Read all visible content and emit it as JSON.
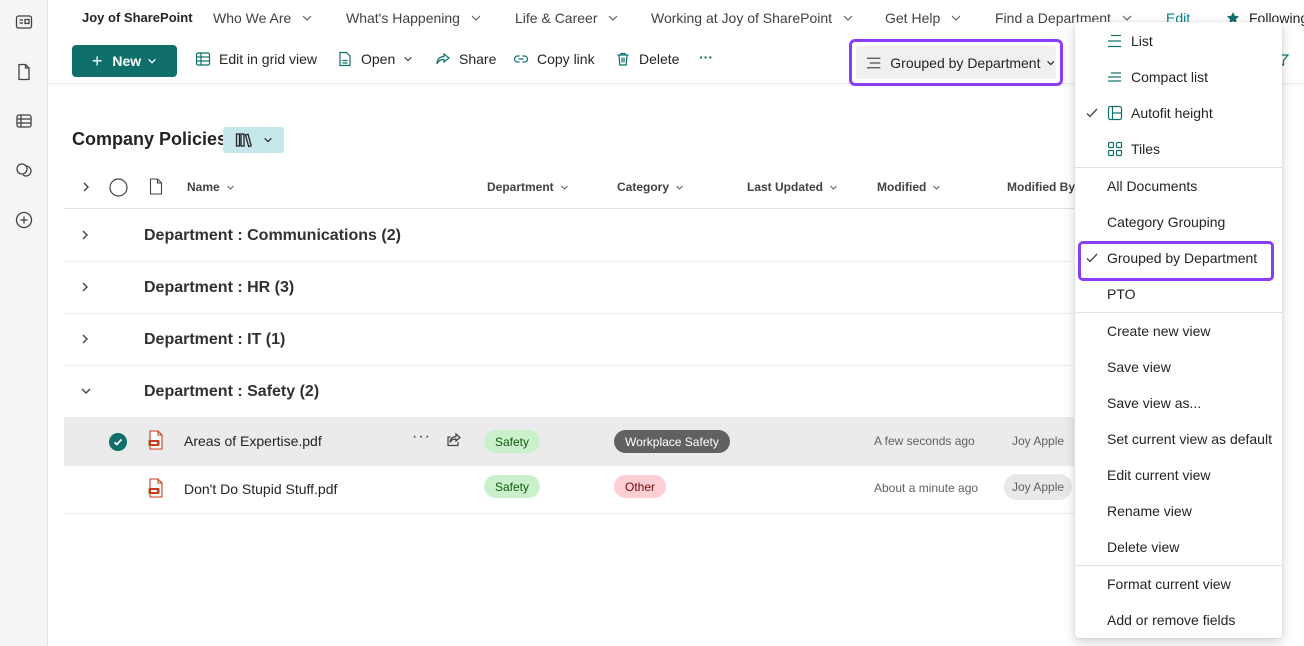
{
  "site": {
    "title": "Joy of SharePoint",
    "nav": [
      {
        "label": "Who We Are"
      },
      {
        "label": "What's Happening"
      },
      {
        "label": "Life & Career"
      },
      {
        "label": "Working at Joy of SharePoint"
      },
      {
        "label": "Get Help"
      },
      {
        "label": "Find a Department"
      }
    ],
    "edit_label": "Edit",
    "following_label": "Following"
  },
  "toolbar": {
    "new_label": "New",
    "edit_grid_label": "Edit in grid view",
    "open_label": "Open",
    "share_label": "Share",
    "copy_link_label": "Copy link",
    "delete_label": "Delete",
    "more_label": "···",
    "current_view_label": "Grouped by Department"
  },
  "library": {
    "title": "Company Policies",
    "columns": {
      "name": "Name",
      "department": "Department",
      "category": "Category",
      "last_updated": "Last Updated",
      "modified": "Modified",
      "modified_by": "Modified By"
    },
    "groups": [
      {
        "label": "Department : Communications (2)",
        "expanded": false
      },
      {
        "label": "Department : HR (3)",
        "expanded": false
      },
      {
        "label": "Department : IT (1)",
        "expanded": false
      },
      {
        "label": "Department : Safety (2)",
        "expanded": true
      }
    ],
    "items": [
      {
        "name": "Areas of Expertise.pdf",
        "department": "Safety",
        "category": "Workplace Safety",
        "modified": "A few seconds ago",
        "modified_by": "Joy Apple",
        "selected": true
      },
      {
        "name": "Don't Do Stupid Stuff.pdf",
        "department": "Safety",
        "category": "Other",
        "modified": "About a minute ago",
        "modified_by": "Joy Apple",
        "selected": false
      }
    ]
  },
  "view_menu": {
    "layouts": [
      {
        "label": "List",
        "checked": false,
        "icon": "list-icon"
      },
      {
        "label": "Compact list",
        "checked": false,
        "icon": "compact-list-icon"
      },
      {
        "label": "Autofit height",
        "checked": true,
        "icon": "autofit-icon"
      },
      {
        "label": "Tiles",
        "checked": false,
        "icon": "tiles-icon"
      }
    ],
    "views": [
      {
        "label": "All Documents",
        "checked": false
      },
      {
        "label": "Category Grouping",
        "checked": false
      },
      {
        "label": "Grouped by Department",
        "checked": true
      },
      {
        "label": "PTO",
        "checked": false
      }
    ],
    "actions": [
      {
        "label": "Create new view"
      },
      {
        "label": "Save view"
      },
      {
        "label": "Save view as..."
      },
      {
        "label": "Set current view as default"
      },
      {
        "label": "Edit current view"
      },
      {
        "label": "Rename view"
      },
      {
        "label": "Delete view"
      }
    ],
    "format": [
      {
        "label": "Format current view"
      },
      {
        "label": "Add or remove fields"
      }
    ]
  },
  "colors": {
    "accent": "#0f6f6b",
    "highlight": "#8a3ff5",
    "safety_pill": "#caf0cc",
    "workplace_pill": "#616161",
    "other_pill": "#fdcfd4"
  }
}
